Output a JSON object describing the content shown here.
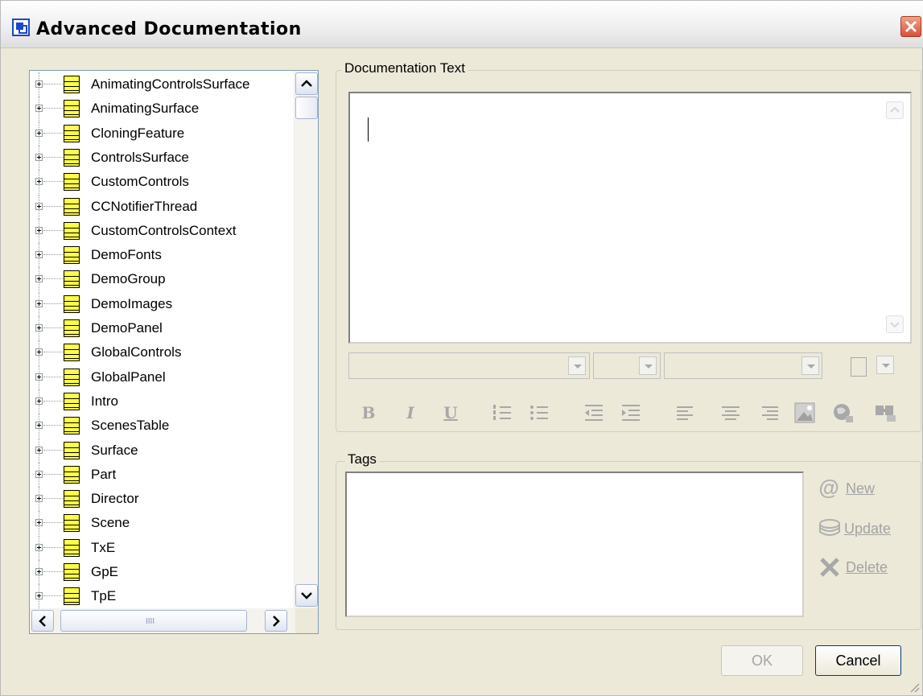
{
  "window": {
    "title": "Advanced Documentation"
  },
  "tree": {
    "items": [
      "AnimatingControlsSurface",
      "AnimatingSurface",
      "CloningFeature",
      "ControlsSurface",
      "CustomControls",
      "CCNotifierThread",
      "CustomControlsContext",
      "DemoFonts",
      "DemoGroup",
      "DemoImages",
      "DemoPanel",
      "GlobalControls",
      "GlobalPanel",
      "Intro",
      "ScenesTable",
      "Surface",
      "Part",
      "Director",
      "Scene",
      "TxE",
      "GpE",
      "TpE"
    ],
    "hscroll_grip": "IIII"
  },
  "documentation": {
    "group_label": "Documentation Text",
    "text": ""
  },
  "formatting": {
    "bold": "B",
    "italic": "I",
    "underline": "U",
    "icons": [
      "numbered-list-icon",
      "bulleted-list-icon",
      "outdent-icon",
      "indent-icon",
      "align-left-icon",
      "align-center-icon",
      "align-right-icon",
      "insert-image-icon",
      "globe-link-icon",
      "binoculars-icon"
    ]
  },
  "tags": {
    "group_label": "Tags",
    "new_label": "New",
    "update_label": "Update",
    "delete_label": "Delete"
  },
  "buttons": {
    "ok": "OK",
    "cancel": "Cancel"
  },
  "colors": {
    "window_bg": "#ece9d8",
    "table_icon": "#ffff4a",
    "close_button": "#d9503a"
  }
}
